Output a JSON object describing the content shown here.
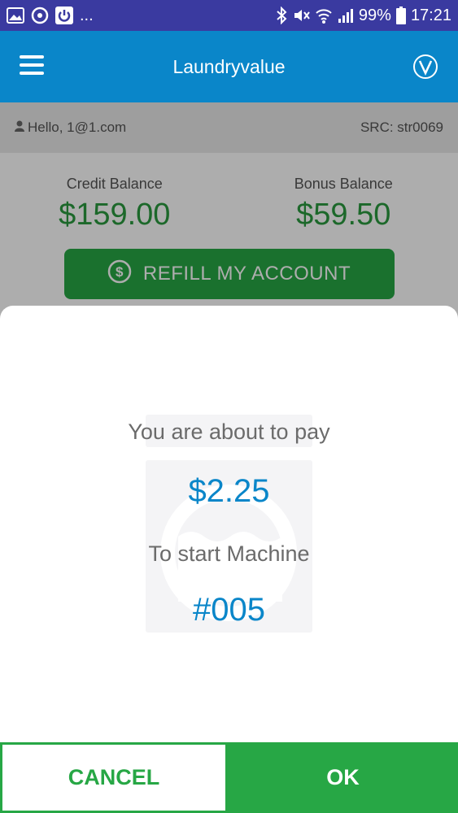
{
  "status_bar": {
    "more": "...",
    "battery": "99%",
    "time": "17:21"
  },
  "app_bar": {
    "title": "Laundryvalue"
  },
  "info": {
    "greeting": "Hello,  1@1.com",
    "src": "SRC: str0069"
  },
  "balances": {
    "credit_label": "Credit Balance",
    "credit_value": "$159.00",
    "bonus_label": "Bonus Balance",
    "bonus_value": "$59.50"
  },
  "refill": {
    "label": "REFILL MY ACCOUNT"
  },
  "dialog": {
    "pay_label": "You are about to pay",
    "amount": "$2.25",
    "start_label": "To start Machine",
    "machine_number": "#005",
    "cancel_label": "CANCEL",
    "ok_label": "OK"
  },
  "colors": {
    "status_bar": "#3a3aa0",
    "app_bar": "#0a86c9",
    "accent_green": "#27a745",
    "accent_blue": "#0a86c9"
  }
}
